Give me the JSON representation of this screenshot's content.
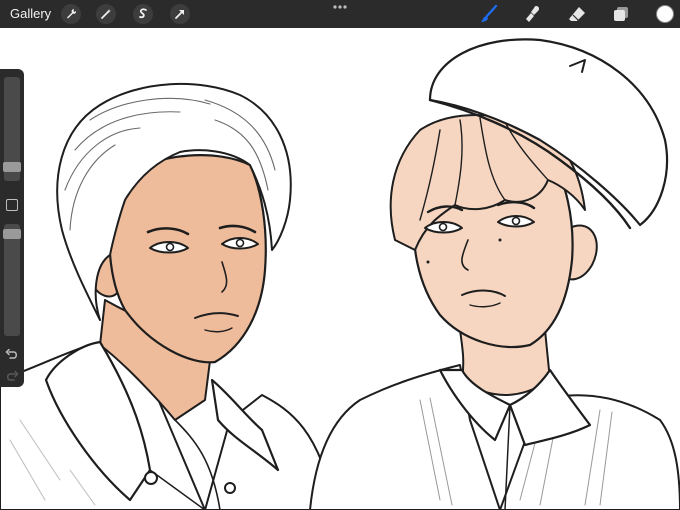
{
  "topbar": {
    "gallery_label": "Gallery",
    "left_tools": [
      "wrench-icon",
      "magic-wand-icon",
      "selection-icon",
      "transform-arrow-icon"
    ],
    "right_tools": [
      "brush-icon",
      "smudge-icon",
      "eraser-icon",
      "layers-icon"
    ],
    "active_tool": "brush",
    "active_color": "#ffffff"
  },
  "sidebar": {
    "brush_size_level": 0.1,
    "opacity_level": 0.05
  },
  "colors": {
    "bar": "#2b2b2b",
    "accent": "#1e6cf0",
    "skin_left": "#efbc9b",
    "skin_right": "#f6d6c0",
    "line": "#1e1e1e"
  }
}
